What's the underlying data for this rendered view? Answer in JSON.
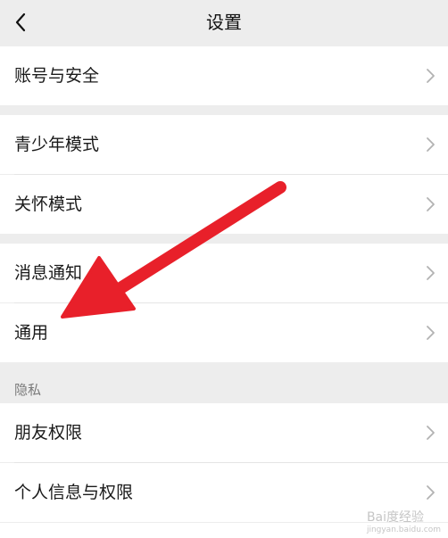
{
  "nav": {
    "title": "设置",
    "back_icon": "chevron-left-icon"
  },
  "groups": [
    {
      "items": [
        {
          "label": "账号与安全"
        }
      ]
    },
    {
      "items": [
        {
          "label": "青少年模式"
        },
        {
          "label": "关怀模式"
        }
      ]
    },
    {
      "items": [
        {
          "label": "消息通知"
        },
        {
          "label": "通用"
        }
      ]
    },
    {
      "header": "隐私",
      "items": [
        {
          "label": "朋友权限"
        },
        {
          "label": "个人信息与权限"
        }
      ]
    }
  ],
  "annotation": {
    "type": "red-arrow",
    "color": "#e8202a",
    "points_to": "通用"
  },
  "watermark": {
    "text": "Bai度经验",
    "sub": "jingyan.baidu.com"
  },
  "colors": {
    "background": "#ededed",
    "row": "#ffffff",
    "chevron": "#b2b2b2"
  }
}
